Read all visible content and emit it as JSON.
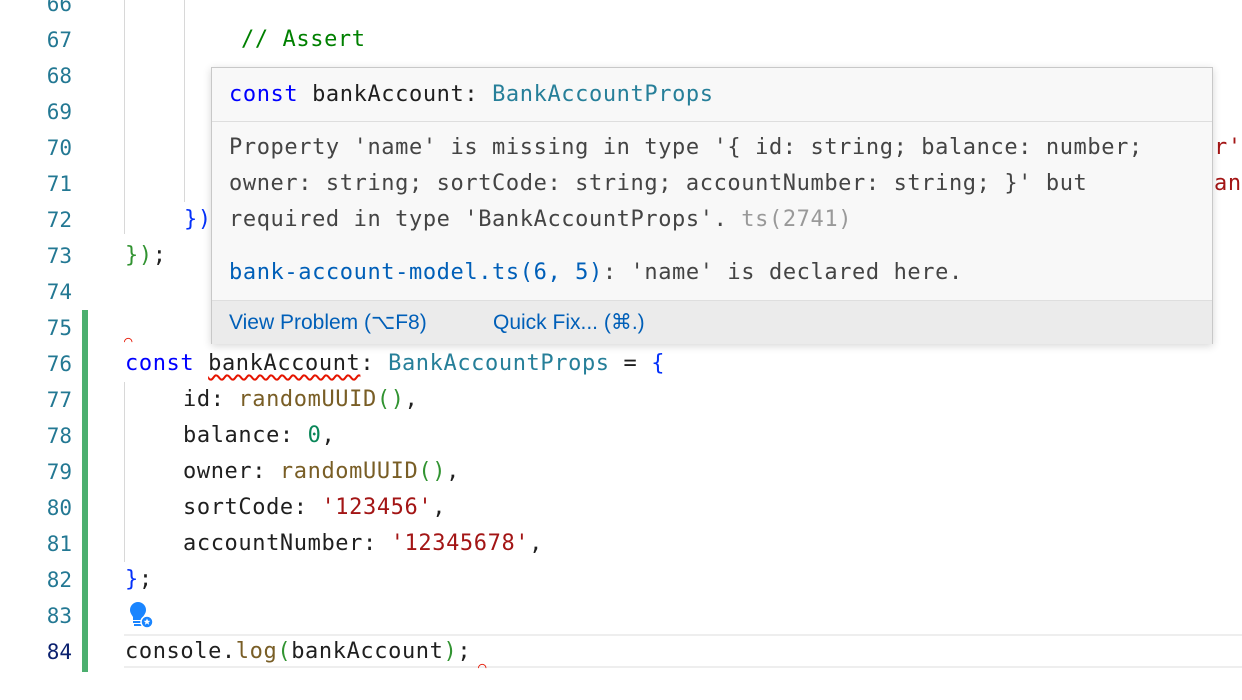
{
  "editor": {
    "lines": [
      {
        "num": "66",
        "content": ""
      },
      {
        "num": "67",
        "comment": "// Assert"
      },
      {
        "num": "68",
        "content": ""
      },
      {
        "num": "69",
        "content": ""
      },
      {
        "num": "70",
        "content": ""
      },
      {
        "num": "71",
        "content": ""
      },
      {
        "num": "72",
        "close": "})"
      },
      {
        "num": "73",
        "close_a": "})",
        "close_b": ";"
      },
      {
        "num": "74",
        "content": ""
      },
      {
        "num": "75",
        "content": ""
      },
      {
        "num": "76",
        "kw": "const",
        "var": "bankAccount",
        "colon": ":",
        "type": "BankAccountProps",
        "eq": " = ",
        "brace": "{"
      },
      {
        "num": "77",
        "prop": "id: ",
        "fn": "randomUUID",
        "paren": "()",
        "tail": ","
      },
      {
        "num": "78",
        "prop": "balance: ",
        "value": "0",
        "tail": ","
      },
      {
        "num": "79",
        "prop": "owner: ",
        "fn": "randomUUID",
        "paren": "()",
        "tail": ","
      },
      {
        "num": "80",
        "prop": "sortCode: ",
        "value": "'123456'",
        "tail": ","
      },
      {
        "num": "81",
        "prop": "accountNumber: ",
        "value": "'12345678'",
        "tail": ","
      },
      {
        "num": "82",
        "brace": "}",
        "tail": ";"
      },
      {
        "num": "83",
        "content": ""
      },
      {
        "num": "84",
        "obj": "console",
        "dot": ".",
        "fn": "log",
        "open": "(",
        "arg": "bankAccount",
        "close": ")",
        "tail": ";"
      }
    ],
    "edge_fragments": {
      "line70": "r'",
      "line71": "anr"
    }
  },
  "hover": {
    "signature": {
      "kw": "const",
      "name": " bankAccount: ",
      "type": "BankAccountProps"
    },
    "message": "Property 'name' is missing in type '{ id: string; balance: number; owner: string; sortCode: string; accountNumber: string; }' but required in type 'BankAccountProps'. ",
    "error_code": "ts(2741)",
    "related_link": "bank-account-model.ts(6, 5)",
    "related_text": ": 'name' is declared here.",
    "actions": {
      "view_problem": "View Problem (⌥F8)",
      "quick_fix": "Quick Fix... (⌘.)"
    }
  },
  "colors": {
    "gutter_modified": "#4caf6f",
    "error": "#e51400",
    "link": "#005fb8",
    "lightbulb": "#1a85ff"
  },
  "icons": {
    "lightbulb": "lightbulb-autofix-icon"
  }
}
